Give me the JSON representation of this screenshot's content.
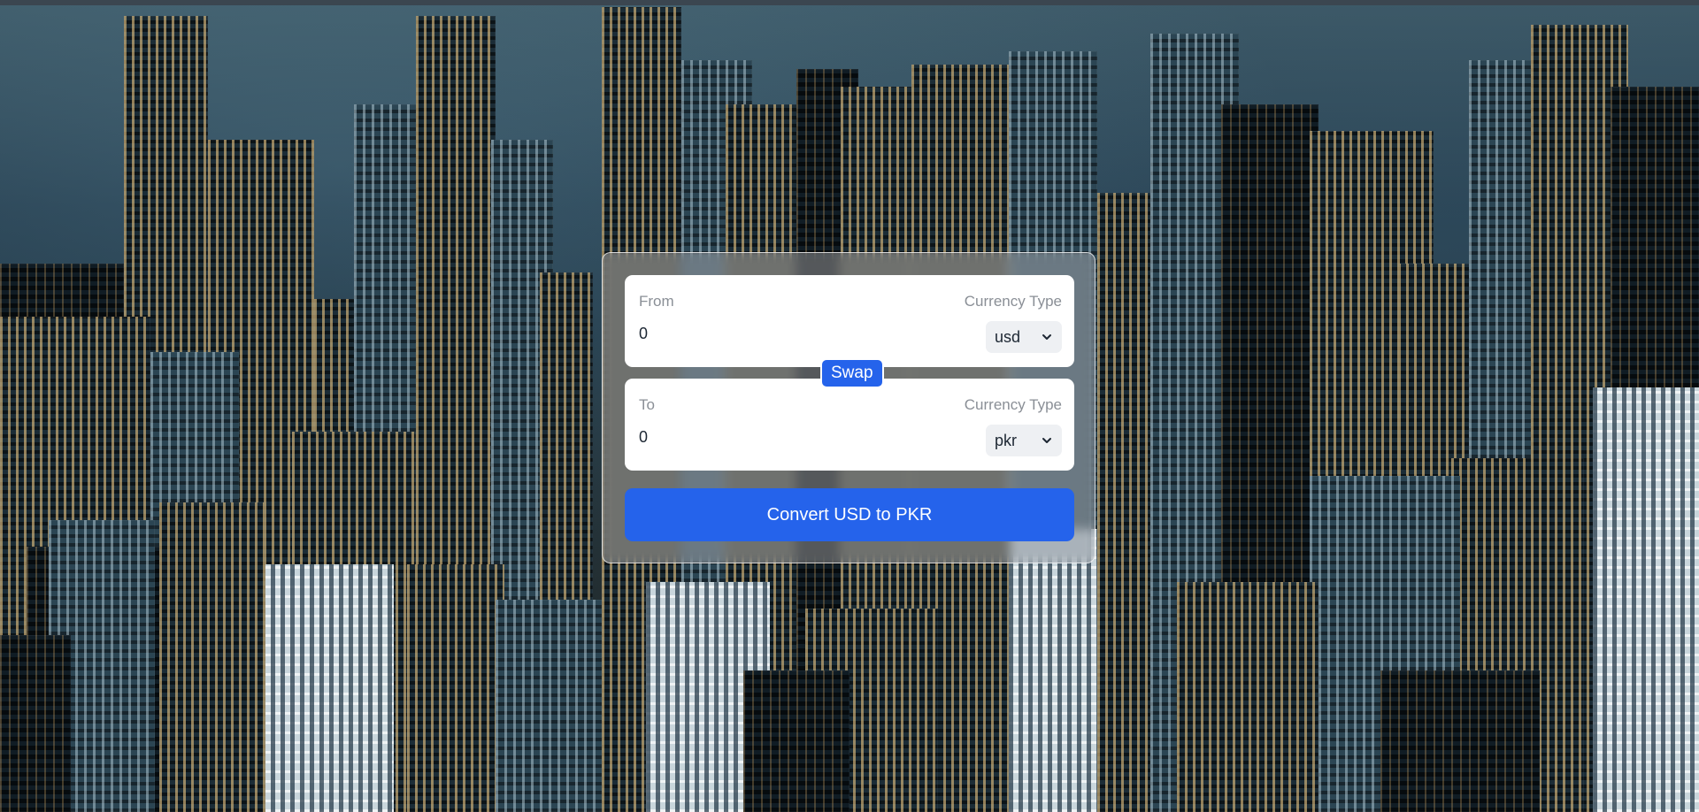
{
  "converter": {
    "from": {
      "label": "From",
      "currency_label": "Currency Type",
      "amount": "0",
      "currency": "usd"
    },
    "to": {
      "label": "To",
      "currency_label": "Currency Type",
      "amount": "0",
      "currency": "pkr"
    },
    "swap_label": "Swap",
    "convert_label": "Convert USD to PKR"
  },
  "colors": {
    "accent": "#2563eb",
    "label_gray": "#8a8f96",
    "select_bg": "#eef0f3"
  },
  "icons": {
    "select_arrow": "chevron-down-icon"
  }
}
